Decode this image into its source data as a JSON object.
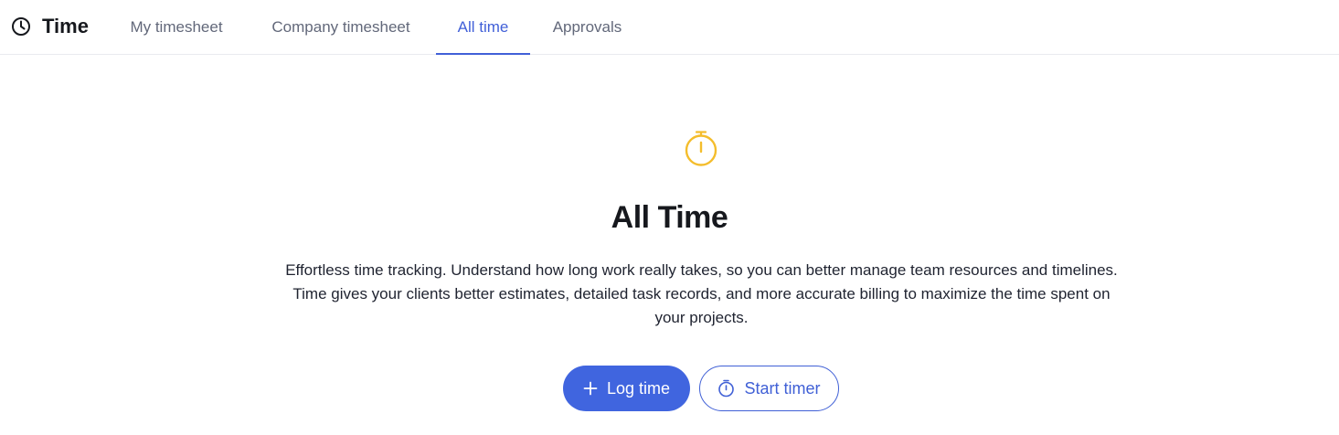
{
  "app": {
    "title": "Time",
    "icon": "clock-icon"
  },
  "tabs": [
    {
      "label": "My timesheet",
      "active": false
    },
    {
      "label": "Company timesheet",
      "active": false
    },
    {
      "label": "All time",
      "active": true
    },
    {
      "label": "Approvals",
      "active": false
    }
  ],
  "hero": {
    "icon": "stopwatch-icon",
    "title": "All Time",
    "description": "Effortless time tracking. Understand how long work really takes, so you can better manage team resources and timelines. Time gives your clients better estimates, detailed task records, and more accurate billing to maximize the time spent on your projects."
  },
  "actions": {
    "log_time": {
      "label": "Log time",
      "icon": "plus-icon"
    },
    "start_timer": {
      "label": "Start timer",
      "icon": "stopwatch-icon"
    }
  },
  "colors": {
    "accent": "#4065df",
    "icon_yellow": "#f4bd2c",
    "text": "#16181d",
    "muted": "#62687a"
  }
}
